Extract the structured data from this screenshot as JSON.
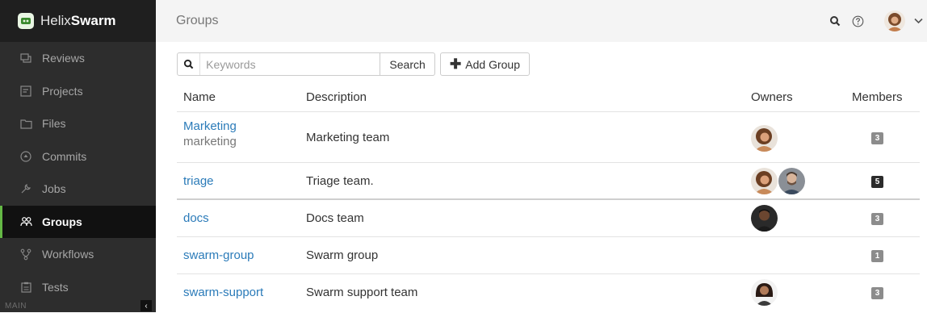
{
  "app": {
    "name_prefix": "Helix",
    "name_bold": "Swarm"
  },
  "sidebar": {
    "items": [
      {
        "label": "Reviews",
        "icon": "reviews-icon"
      },
      {
        "label": "Projects",
        "icon": "projects-icon"
      },
      {
        "label": "Files",
        "icon": "folder-icon"
      },
      {
        "label": "Commits",
        "icon": "commits-icon"
      },
      {
        "label": "Jobs",
        "icon": "wrench-icon"
      },
      {
        "label": "Groups",
        "icon": "groups-icon",
        "active": true
      },
      {
        "label": "Workflows",
        "icon": "workflow-icon"
      },
      {
        "label": "Tests",
        "icon": "tests-icon"
      }
    ],
    "footer_label": "MAIN",
    "collapse_glyph": "‹"
  },
  "header": {
    "title": "Groups"
  },
  "toolbar": {
    "search_placeholder": "Keywords",
    "search_value": "",
    "search_button": "Search",
    "add_button": "Add Group",
    "add_plus": "✚"
  },
  "table": {
    "columns": {
      "name": "Name",
      "description": "Description",
      "owners": "Owners",
      "members": "Members"
    },
    "rows": [
      {
        "name": "Marketing",
        "id": "marketing",
        "description": "Marketing team",
        "members": "3",
        "owners": [
          "woman-curly-hair-avatar"
        ]
      },
      {
        "name": "triage",
        "description": "Triage team.",
        "members": "5",
        "owners": [
          "woman-curly-hair-avatar",
          "man-beard-avatar"
        ]
      },
      {
        "name": "docs",
        "description": "Docs team",
        "members": "3",
        "owners": [
          "dark-man-avatar"
        ]
      },
      {
        "name": "swarm-group",
        "description": "Swarm group",
        "members": "1",
        "owners": []
      },
      {
        "name": "swarm-support",
        "description": "Swarm support team",
        "members": "3",
        "owners": [
          "woman-long-hair-avatar"
        ]
      }
    ]
  },
  "colors": {
    "accent": "#64b845",
    "link": "#2b7bb9",
    "sidebar_bg": "#2d2d2d"
  }
}
